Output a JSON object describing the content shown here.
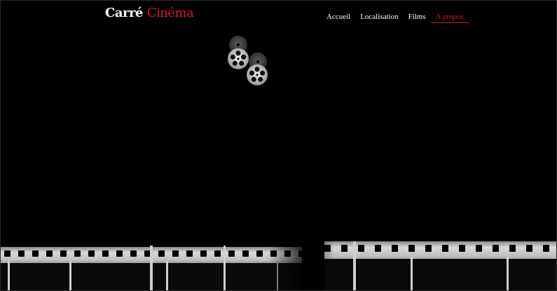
{
  "brand": {
    "name_first": "Carré",
    "name_second": "Cinéma",
    "accent_color": "#c8202c"
  },
  "nav": {
    "items": [
      {
        "label": "Accueil",
        "active": false
      },
      {
        "label": "Localisation",
        "active": false
      },
      {
        "label": "Films",
        "active": false
      },
      {
        "label": "A propos",
        "active": true
      }
    ]
  },
  "decor": {
    "reels_icon": "film-reels-icon",
    "filmstrip_icon": "filmstrip-icon"
  }
}
